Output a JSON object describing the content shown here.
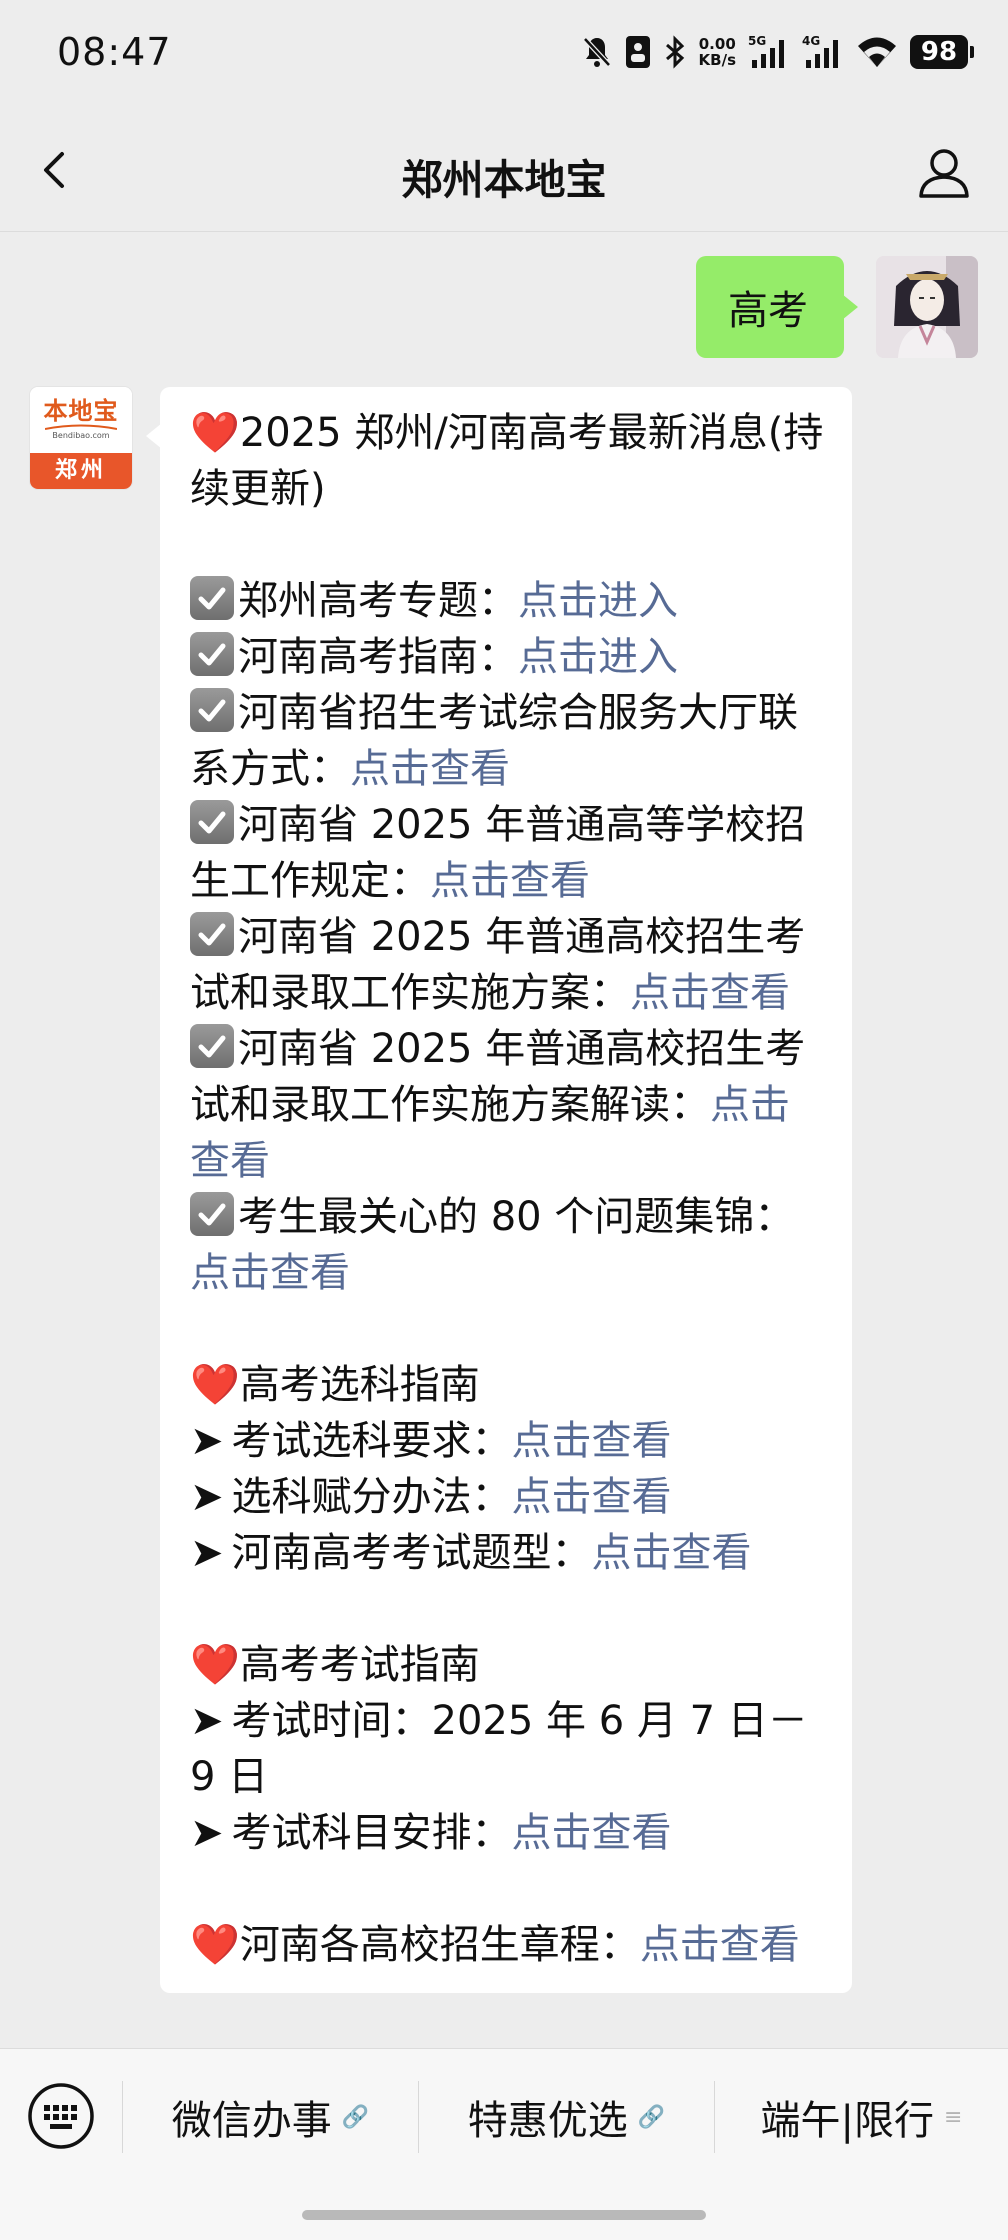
{
  "status_bar": {
    "time": "08:47",
    "net_speed_value": "0.00",
    "net_speed_unit": "KB/s",
    "signal1_label": "5G",
    "signal2_label": "4G",
    "battery": "98"
  },
  "nav": {
    "title": "郑州本地宝"
  },
  "chat": {
    "user_message": "高考",
    "bot_avatar": {
      "logo_text": "本地宝",
      "logo_subtext": "Bendibao.com",
      "city": "郑州"
    },
    "bot_message": {
      "heading": "2025 郑州/河南高考最新消息(持续更新)",
      "heading_icon": "❤️",
      "items_checked": [
        {
          "text": "郑州高考专题：",
          "link": "点击进入"
        },
        {
          "text": "河南高考指南：",
          "link": "点击进入"
        },
        {
          "text": "河南省招生考试综合服务大厅联系方式：",
          "link": "点击查看"
        },
        {
          "text": "河南省 2025 年普通高等学校招生工作规定：",
          "link": "点击查看"
        },
        {
          "text": "河南省 2025 年普通高校招生考试和录取工作实施方案：",
          "link": "点击查看"
        },
        {
          "text": "河南省 2025 年普通高校招生考试和录取工作实施方案解读：",
          "link": "点击查看"
        },
        {
          "text": "考生最关心的 80 个问题集锦：",
          "link": "点击查看"
        }
      ],
      "section2_heading": "高考选科指南",
      "section2_items": [
        {
          "text": "考试选科要求：",
          "link": "点击查看"
        },
        {
          "text": "选科赋分办法：",
          "link": "点击查看"
        },
        {
          "text": "河南高考考试题型：",
          "link": "点击查看"
        }
      ],
      "section3_heading": "高考考试指南",
      "section3_items": [
        {
          "text": "考试时间：2025 年 6 月 7 日－9 日",
          "link": ""
        },
        {
          "text": "考试科目安排：",
          "link": "点击查看"
        }
      ],
      "section4_text": "河南各高校招生章程：",
      "section4_link": "点击查看"
    }
  },
  "menu": {
    "items": [
      {
        "label": "微信办事"
      },
      {
        "label": "特惠优选"
      },
      {
        "label": "端午|限行"
      }
    ]
  },
  "colors": {
    "link": "#576b95",
    "user_bubble": "#95ec69",
    "bg": "#ededed"
  }
}
